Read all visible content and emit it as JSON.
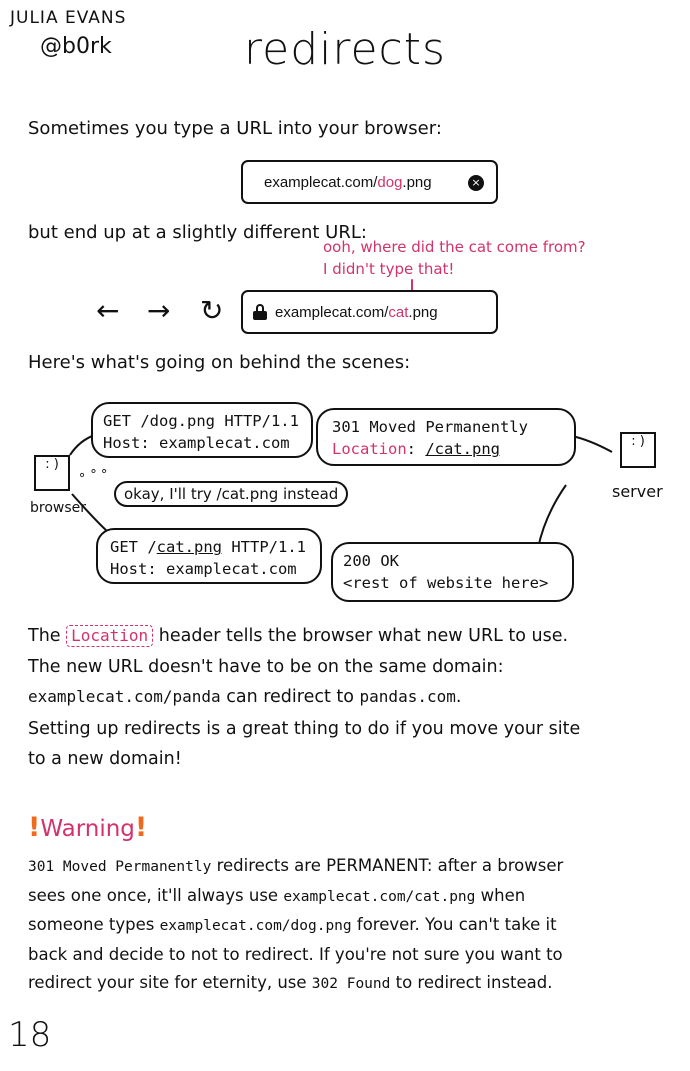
{
  "header": {
    "author_name": "JULIA EVANS",
    "author_handle": "@b0rk",
    "title": "redirects"
  },
  "intro": {
    "line1": "Sometimes you type a URL into your browser:",
    "url1_prefix": "examplecat.com/",
    "url1_highlight": "dog",
    "url1_suffix": ".png",
    "clear_icon": "×",
    "line2": "but end up at a slightly different URL:",
    "annotation_line1": "ooh, where did the cat come from?",
    "annotation_line2": "I didn't type that!",
    "nav_back": "←",
    "nav_forward": "→",
    "nav_reload": "↻",
    "url2_prefix": "examplecat.com/",
    "url2_highlight": "cat",
    "url2_suffix": ".png",
    "line3": "Here's what's going on behind the scenes:"
  },
  "diagram": {
    "browser_label": "browser",
    "server_label": "server",
    "face": ": )",
    "req1_line1": "GET /dog.png HTTP/1.1",
    "req1_line2": "Host: examplecat.com",
    "resp1_line1": "301 Moved Permanently",
    "resp1_loc_key": "Location",
    "resp1_loc_sep": ": ",
    "resp1_loc_val": "/cat.png",
    "thought_dots": "∘ ° °",
    "thought": "okay, I'll try /cat.png instead",
    "req2_get": "GET /",
    "req2_path": "cat.png",
    "req2_rest": " HTTP/1.1",
    "req2_line2": "Host: examplecat.com",
    "resp2_line1": "200 OK",
    "resp2_line2": "<rest of website here>"
  },
  "explanation": {
    "p1_pre": "The ",
    "p1_tag": "Location",
    "p1_post": " header tells the browser what new URL to use.",
    "p2": "The new URL doesn't have to be on the same domain:",
    "p3_code1": "examplecat.com/panda",
    "p3_mid": " can redirect to ",
    "p3_code2": "pandas.com",
    "p3_end": ".",
    "p4": "Setting up redirects is a great thing to do if you move your site",
    "p5": "to a new domain!"
  },
  "warning": {
    "bang": "!",
    "title": "Warning",
    "l1_code": "301 Moved Permanently",
    "l1_rest": " redirects are PERMANENT: after a browser",
    "l2_pre": "sees one once, it'll always use ",
    "l2_code": "examplecat.com/cat.png",
    "l2_post": " when",
    "l3_pre": "someone types ",
    "l3_code": "examplecat.com/dog.png",
    "l3_post": " forever. You can't take it",
    "l4": "back and decide to not to redirect. If you're not sure you want to",
    "l5_pre": "redirect your site for eternity, use ",
    "l5_code": "302 Found",
    "l5_post": " to redirect instead."
  },
  "footer": {
    "page_number": "18"
  }
}
